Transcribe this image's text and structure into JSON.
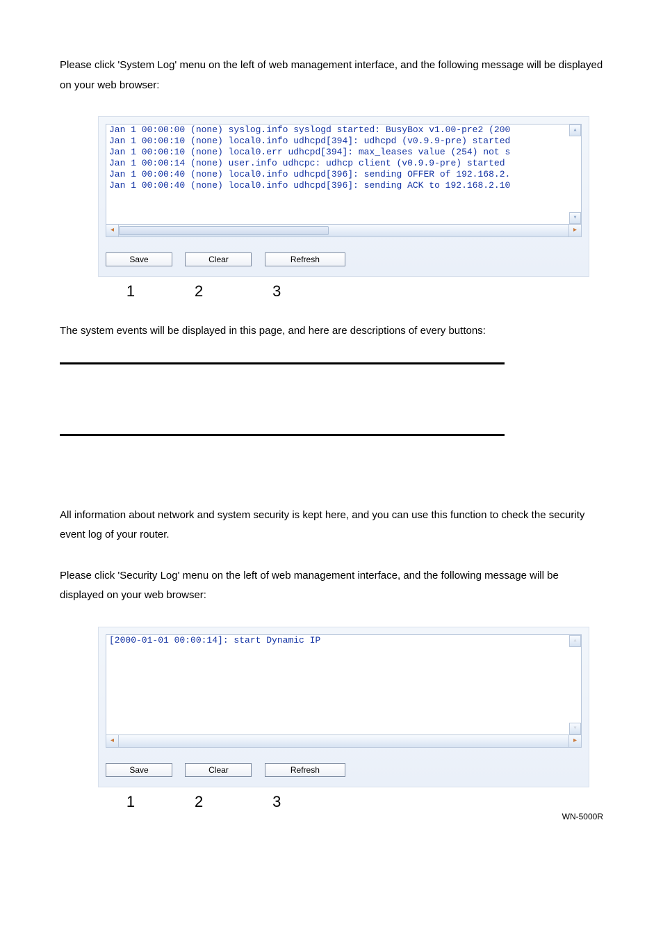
{
  "intro1": "Please click 'System Log' menu on the left of web management interface, and the following message will be displayed on your web browser:",
  "panel1": {
    "lines": [
      "Jan  1 00:00:00 (none) syslog.info syslogd started: BusyBox v1.00-pre2 (200",
      "Jan  1 00:00:10 (none) local0.info udhcpd[394]: udhcpd (v0.9.9-pre) started",
      "Jan  1 00:00:10 (none) local0.err udhcpd[394]: max_leases value (254) not s",
      "Jan  1 00:00:14 (none) user.info udhcpc: udhcp client (v0.9.9-pre) started",
      "Jan  1 00:00:40 (none) local0.info udhcpd[396]: sending OFFER of 192.168.2.",
      "Jan  1 00:00:40 (none) local0.info udhcpd[396]: sending ACK to 192.168.2.10"
    ],
    "buttons": {
      "save": "Save",
      "clear": "Clear",
      "refresh": "Refresh"
    },
    "nums": {
      "n1": "1",
      "n2": "2",
      "n3": "3"
    }
  },
  "mid": "The system events will be displayed in this page, and here are descriptions of every buttons:",
  "sec_intro1": "All information about network and system security is kept here, and you can use this function to check the security event log of your router.",
  "sec_intro2": "Please click 'Security Log' menu on the left of web management interface, and the following message will be displayed on your web browser:",
  "panel2": {
    "lines": [
      "[2000-01-01 00:00:14]: start Dynamic IP"
    ],
    "buttons": {
      "save": "Save",
      "clear": "Clear",
      "refresh": "Refresh"
    },
    "nums": {
      "n1": "1",
      "n2": "2",
      "n3": "3"
    }
  },
  "footer": "WN-5000R"
}
